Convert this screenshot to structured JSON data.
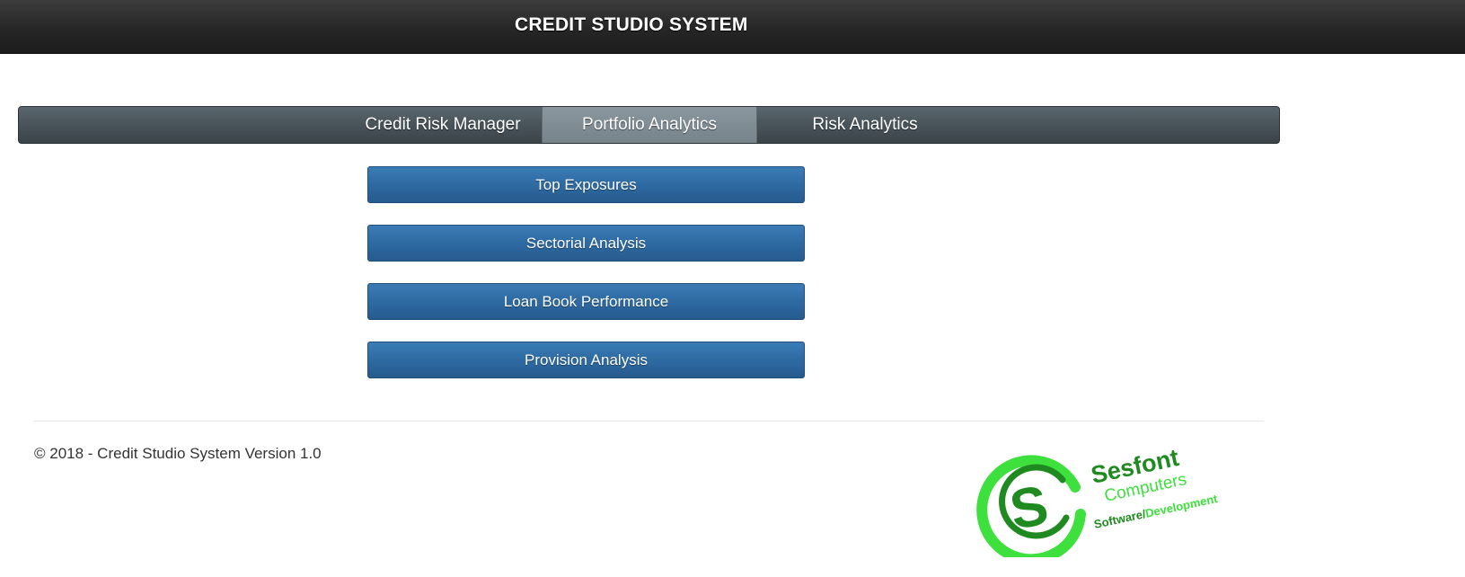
{
  "header": {
    "title": "CREDIT STUDIO SYSTEM"
  },
  "tabs": [
    {
      "label": "Credit Risk Manager",
      "active": false
    },
    {
      "label": "Portfolio Analytics",
      "active": true
    },
    {
      "label": "Risk Analytics",
      "active": false
    }
  ],
  "menu": {
    "buttons": [
      {
        "label": "Top Exposures"
      },
      {
        "label": "Sectorial Analysis"
      },
      {
        "label": "Loan Book Performance"
      },
      {
        "label": "Provision Analysis"
      }
    ]
  },
  "footer": {
    "copyright": "© 2018 - Credit Studio System Version 1.0"
  },
  "logo": {
    "name": "Sesfont",
    "line2": "Computers",
    "line3a": "Software/",
    "line3b": "Development"
  },
  "colors": {
    "header_bg": "#262626",
    "tabbar_bg": "#49545a",
    "active_tab_bg": "#7f8c93",
    "button_bg": "#2e6aa2",
    "logo_dark_green": "#1f8a1f",
    "logo_light_green": "#3ee03e"
  }
}
